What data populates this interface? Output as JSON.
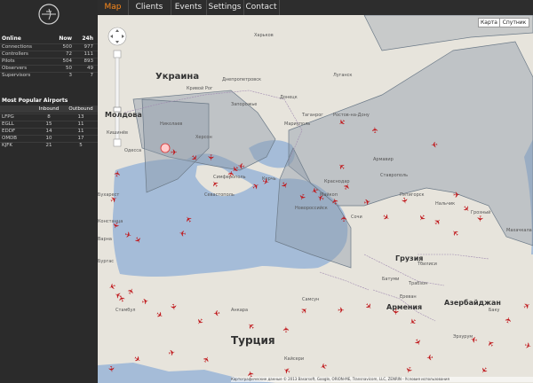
{
  "nav": {
    "tabs": [
      {
        "label": "Map",
        "active": true
      },
      {
        "label": "Clients",
        "active": false
      },
      {
        "label": "Events",
        "active": false
      },
      {
        "label": "Settings",
        "active": false
      },
      {
        "label": "Contact",
        "active": false
      }
    ]
  },
  "sidebar": {
    "online": {
      "title": "Online",
      "col_now": "Now",
      "col_24h": "24h",
      "rows": [
        {
          "label": "Connections",
          "now": "500",
          "h24": "977"
        },
        {
          "label": "Controllers",
          "now": "72",
          "h24": "111"
        },
        {
          "label": "Pilots",
          "now": "504",
          "h24": "893"
        },
        {
          "label": "Observers",
          "now": "50",
          "h24": "49"
        },
        {
          "label": "Supervisors",
          "now": "3",
          "h24": "7"
        }
      ]
    },
    "airports": {
      "title": "Most Popular Airports",
      "col_inbound": "Inbound",
      "col_outbound": "Outbound",
      "rows": [
        {
          "icao": "LFPG",
          "inbound": "8",
          "outbound": "13"
        },
        {
          "icao": "EGLL",
          "inbound": "15",
          "outbound": "11"
        },
        {
          "icao": "EDDF",
          "inbound": "14",
          "outbound": "11"
        },
        {
          "icao": "OMDB",
          "inbound": "10",
          "outbound": "17"
        },
        {
          "icao": "KJFK",
          "inbound": "21",
          "outbound": "5"
        }
      ]
    }
  },
  "map": {
    "type_buttons": [
      "Карта",
      "Спутник"
    ],
    "copyright": "Картографические данные © 2013 Basarsoft, Google, ORION-ME, Transnavicom, LLC, ZENRIN - Условия использования",
    "countries": [
      {
        "name": "Украина"
      },
      {
        "name": "Молдова"
      },
      {
        "name": "Грузия"
      },
      {
        "name": "Армения"
      },
      {
        "name": "Азербайджан"
      },
      {
        "name": "Турция"
      }
    ],
    "cities": [
      "Харьков",
      "Днепропетровск",
      "Донецк",
      "Луганск",
      "Запорожье",
      "Кривой Рог",
      "Николаев",
      "Херсон",
      "Мариуполь",
      "Ростов-на-Дону",
      "Таганрог",
      "Краснодар",
      "Ставрополь",
      "Одесса",
      "Кишинёв",
      "Севастополь",
      "Симферополь",
      "Керчь",
      "Новороссийск",
      "Сочи",
      "Тбилиси",
      "Ереван",
      "Баку",
      "Батуми",
      "Трабзон",
      "Самсун",
      "Анкара",
      "Стамбул",
      "Эрзурум",
      "Кайсери",
      "Варна",
      "Бургас",
      "Констанца",
      "Бухарест",
      "Пятигорск",
      "Нальчик",
      "Майкоп",
      "Армавир",
      "Грозный",
      "Махачкала"
    ]
  },
  "colors": {
    "accent": "#ff8a1a",
    "sea": "#a5bcd8",
    "land": "#e7e4dc",
    "region": "#8e9baa",
    "plane": "#c0171b"
  }
}
